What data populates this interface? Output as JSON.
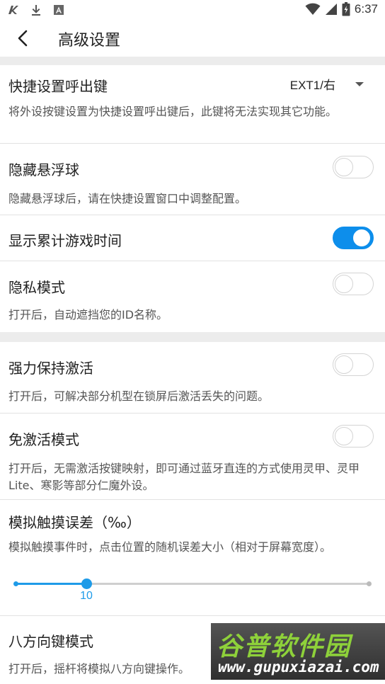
{
  "status_bar": {
    "time": "6:37",
    "left_icons": [
      "app-logo-icon",
      "download-icon",
      "notification-a-icon"
    ],
    "right_icons": [
      "wifi-icon",
      "signal-icon",
      "battery-icon"
    ]
  },
  "app_bar": {
    "title": "高级设置",
    "back_icon": "back-arrow-icon"
  },
  "settings": {
    "shortcut_key": {
      "title": "快捷设置呼出键",
      "value": "EXT1/右",
      "desc": "将外设按键设置为快捷设置呼出键后，此键将无法实现其它功能。"
    },
    "hide_float": {
      "title": "隐藏悬浮球",
      "desc": "隐藏悬浮球后，请在快捷设置窗口中调整配置。",
      "enabled": false
    },
    "show_time": {
      "title": "显示累计游戏时间",
      "enabled": true
    },
    "privacy": {
      "title": "隐私模式",
      "desc": "打开后，自动遮挡您的ID名称。",
      "enabled": false
    },
    "keep_active": {
      "title": "强力保持激活",
      "desc": "打开后，可解决部分机型在锁屏后激活丢失的问题。",
      "enabled": false
    },
    "no_activation": {
      "title": "免激活模式",
      "desc": "打开后，无需激活按键映射，即可通过蓝牙直连的方式使用灵甲、灵甲Lite、寒影等部分仁魔外设。",
      "enabled": false
    },
    "touch_error": {
      "title": "模拟触摸误差（‰）",
      "desc": "模拟触摸事件时，点击位置的随机误差大小（相对于屏幕宽度）。",
      "value": "10",
      "fraction": 0.2
    },
    "eight_dir": {
      "title": "八方向键模式",
      "desc": "打开后，摇杆将模拟八方向键操作。"
    }
  },
  "watermark": {
    "brand": "谷普软件园",
    "url": "www.gupuxiazai.com"
  },
  "colors": {
    "accent": "#0d8eeb",
    "slider": "#1e9be8",
    "background": "#f2f2f2"
  }
}
